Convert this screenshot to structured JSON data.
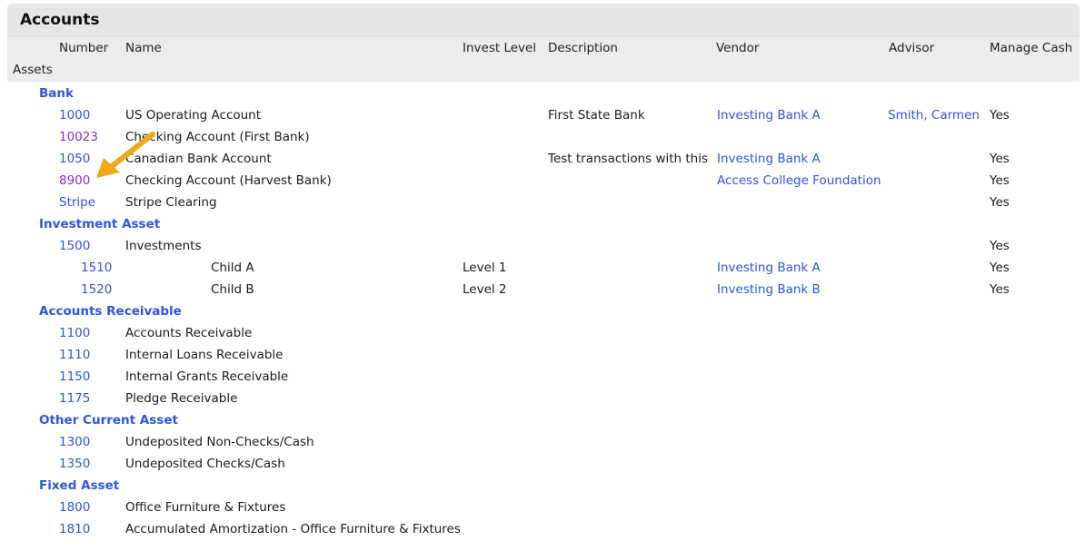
{
  "page_title": "Accounts",
  "columns": {
    "number": "Number",
    "name": "Name",
    "invest_level": "Invest Level",
    "description": "Description",
    "vendor": "Vendor",
    "advisor": "Advisor",
    "manage_cash": "Manage Cash"
  },
  "section": "Assets",
  "categories": {
    "bank": "Bank",
    "investment_asset": "Investment Asset",
    "accounts_receivable": "Accounts Receivable",
    "other_current_asset": "Other Current Asset",
    "fixed_asset": "Fixed Asset"
  },
  "rows": {
    "r1000": {
      "number": "1000",
      "name": "US Operating Account",
      "description": "First State Bank",
      "vendor": "Investing Bank A",
      "advisor": "Smith, Carmen",
      "manage_cash": "Yes"
    },
    "r10023": {
      "number": "10023",
      "name": "Checking Account (First Bank)"
    },
    "r1050": {
      "number": "1050",
      "name": "Canadian Bank Account",
      "description": "Test transactions with this",
      "vendor": "Investing Bank A",
      "manage_cash": "Yes"
    },
    "r8900": {
      "number": "8900",
      "name": "Checking Account (Harvest Bank)",
      "vendor": "Access College Foundation",
      "manage_cash": "Yes"
    },
    "rstripe": {
      "number": "Stripe",
      "name": "Stripe Clearing",
      "manage_cash": "Yes"
    },
    "r1500": {
      "number": "1500",
      "name": "Investments",
      "manage_cash": "Yes"
    },
    "r1510": {
      "number": "1510",
      "name": "Child A",
      "invest_level": "Level 1",
      "vendor": "Investing Bank A",
      "manage_cash": "Yes"
    },
    "r1520": {
      "number": "1520",
      "name": "Child B",
      "invest_level": "Level 2",
      "vendor": "Investing Bank B",
      "manage_cash": "Yes"
    },
    "r1100": {
      "number": "1100",
      "name": "Accounts Receivable"
    },
    "r1110": {
      "number": "1110",
      "name": "Internal Loans Receivable"
    },
    "r1150": {
      "number": "1150",
      "name": "Internal Grants Receivable"
    },
    "r1175": {
      "number": "1175",
      "name": "Pledge Receivable"
    },
    "r1300": {
      "number": "1300",
      "name": "Undeposited Non-Checks/Cash"
    },
    "r1350": {
      "number": "1350",
      "name": "Undeposited Checks/Cash"
    },
    "r1800": {
      "number": "1800",
      "name": "Office Furniture & Fixtures"
    },
    "r1810": {
      "number": "1810",
      "name": "Accumulated Amortization - Office Furniture & Fixtures"
    }
  },
  "colors": {
    "link": "#2d55e8",
    "visited_link": "#8a2bd1",
    "arrow": "#f0a818",
    "header_bg": "#e6e6e6"
  },
  "icons": {
    "annotation": "arrow-annotation-icon"
  }
}
